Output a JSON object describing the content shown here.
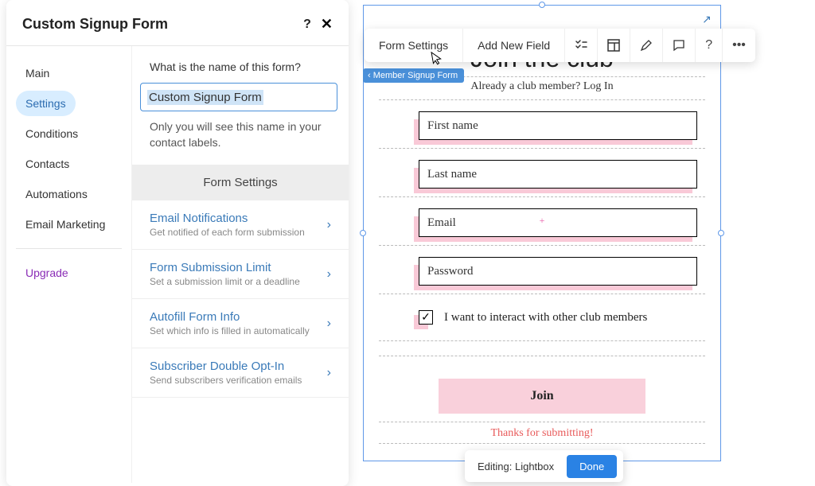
{
  "panel": {
    "title": "Custom Signup Form",
    "question": "What is the name of this form?",
    "name_value": "Custom Signup Form",
    "hint": "Only you will see this name in your contact labels.",
    "section_header": "Form Settings"
  },
  "sidebar": {
    "items": [
      "Main",
      "Settings",
      "Conditions",
      "Contacts",
      "Automations",
      "Email Marketing"
    ],
    "upgrade": "Upgrade"
  },
  "settings": [
    {
      "title": "Email Notifications",
      "sub": "Get notified of each form submission"
    },
    {
      "title": "Form Submission Limit",
      "sub": "Set a submission limit or a deadline"
    },
    {
      "title": "Autofill Form Info",
      "sub": "Set which info is filled in automatically"
    },
    {
      "title": "Subscriber Double Opt-In",
      "sub": "Send subscribers verification emails"
    }
  ],
  "toolbar": {
    "form_settings": "Form Settings",
    "add_field": "Add New Field"
  },
  "tag": "Member Signup Form",
  "form": {
    "title": "Join the club",
    "already": "Already a club member? Log In",
    "fields": [
      "First name",
      "Last name",
      "Email",
      "Password"
    ],
    "checkbox": "I want to interact with other club members",
    "submit": "Join",
    "thanks": "Thanks for submitting!"
  },
  "editbar": {
    "label": "Editing: Lightbox",
    "done": "Done"
  }
}
